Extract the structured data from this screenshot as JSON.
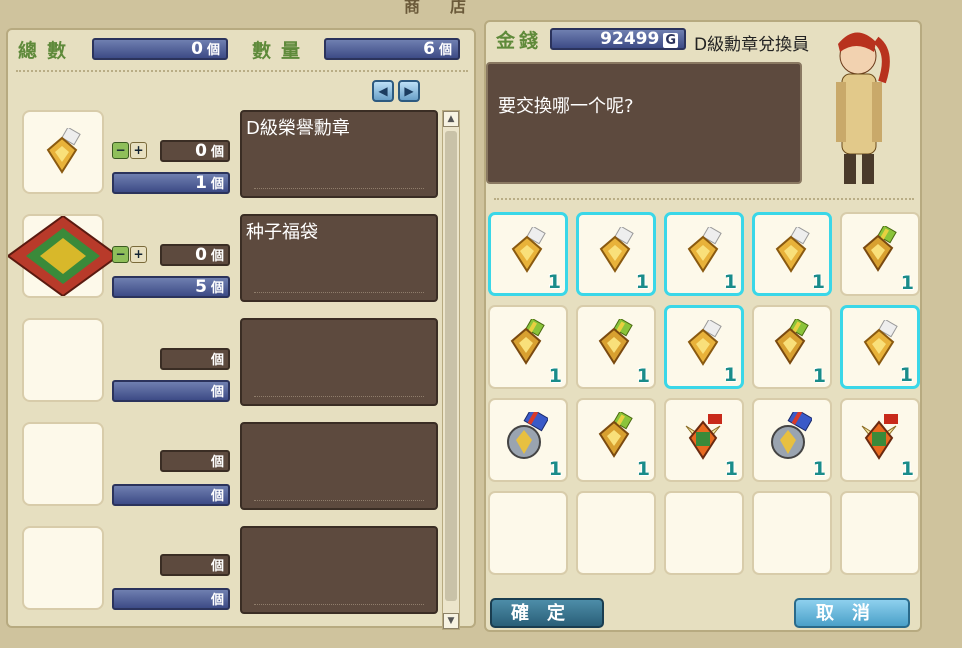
{
  "window": {
    "title": "商店"
  },
  "left": {
    "total_label": "總數",
    "total_value": "0",
    "qty_label": "數量",
    "qty_value": "6",
    "unit": "個",
    "rows": [
      {
        "name": "D級榮譽勳章",
        "qty": "0",
        "price": "1",
        "icon": "gold-medal-icon"
      },
      {
        "name": "种子福袋",
        "qty": "0",
        "price": "5",
        "icon": "seed-bag-icon"
      },
      {
        "name": "",
        "qty": "",
        "price": "",
        "icon": ""
      },
      {
        "name": "",
        "qty": "",
        "price": "",
        "icon": ""
      },
      {
        "name": "",
        "qty": "",
        "price": "",
        "icon": ""
      }
    ]
  },
  "right": {
    "money_label": "金錢",
    "money_value": "92499",
    "money_unit": "G",
    "npc_name": "D級勳章兌換員",
    "npc_message": "要交換哪一个呢?",
    "inventory": [
      {
        "icon": "silver-medal-icon",
        "count": "1",
        "selected": true
      },
      {
        "icon": "silver-medal-icon",
        "count": "1",
        "selected": true
      },
      {
        "icon": "silver-medal-icon",
        "count": "1",
        "selected": true
      },
      {
        "icon": "silver-medal-icon",
        "count": "1",
        "selected": true
      },
      {
        "icon": "green-ribbon-medal-icon",
        "count": "1",
        "selected": false
      },
      {
        "icon": "green-ribbon-medal-icon",
        "count": "1",
        "selected": false
      },
      {
        "icon": "green-ribbon-medal-icon",
        "count": "1",
        "selected": false
      },
      {
        "icon": "silver-medal-icon",
        "count": "1",
        "selected": true
      },
      {
        "icon": "green-ribbon-medal-icon",
        "count": "1",
        "selected": false
      },
      {
        "icon": "silver-medal-icon",
        "count": "1",
        "selected": true
      },
      {
        "icon": "blue-ribbon-medal-icon",
        "count": "1",
        "selected": false
      },
      {
        "icon": "green-ribbon-medal-icon",
        "count": "1",
        "selected": false
      },
      {
        "icon": "winged-emblem-icon",
        "count": "1",
        "selected": false
      },
      {
        "icon": "blue-ribbon-medal-icon",
        "count": "1",
        "selected": false
      },
      {
        "icon": "winged-emblem-icon",
        "count": "1",
        "selected": false
      },
      {
        "icon": "",
        "count": "",
        "selected": false
      },
      {
        "icon": "",
        "count": "",
        "selected": false
      },
      {
        "icon": "",
        "count": "",
        "selected": false
      },
      {
        "icon": "",
        "count": "",
        "selected": false
      },
      {
        "icon": "",
        "count": "",
        "selected": false
      }
    ],
    "confirm_label": "確定",
    "cancel_label": "取消"
  },
  "colors": {
    "accent": "#3ad7e8",
    "count": "#1a8c8a",
    "label": "#5f8a3a"
  }
}
